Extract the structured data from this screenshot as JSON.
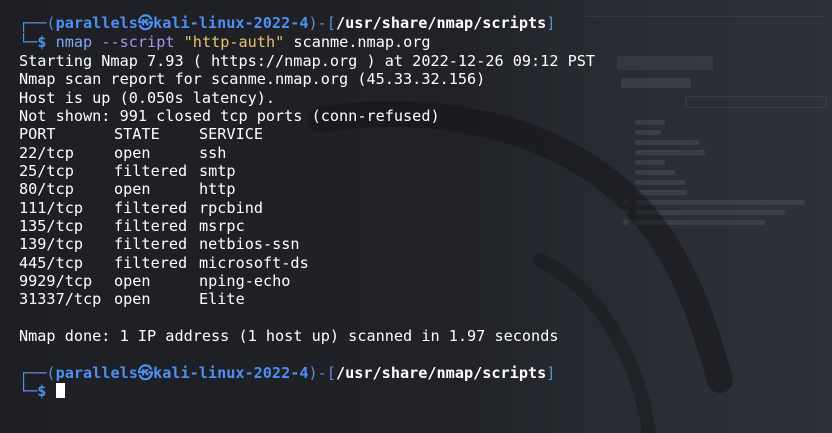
{
  "prompt": {
    "user": "parallels",
    "at_symbol": "㉿",
    "host": "kali-linux-2022-4",
    "path": "/usr/share/nmap/scripts",
    "symbol": "$"
  },
  "command": {
    "program": "nmap",
    "option": "--script",
    "script_name": "\"http-auth\"",
    "target": "scanme.nmap.org"
  },
  "output": {
    "start_line": "Starting Nmap 7.93 ( https://nmap.org ) at 2022-12-26 09:12 PST",
    "report_line": "Nmap scan report for scanme.nmap.org (45.33.32.156)",
    "host_up": "Host is up (0.050s latency).",
    "not_shown": "Not shown: 991 closed tcp ports (conn-refused)",
    "headers": {
      "port": "PORT",
      "state": "STATE",
      "service": "SERVICE"
    },
    "ports": [
      {
        "port": "22/tcp",
        "state": "open",
        "service": "ssh"
      },
      {
        "port": "25/tcp",
        "state": "filtered",
        "service": "smtp"
      },
      {
        "port": "80/tcp",
        "state": "open",
        "service": "http"
      },
      {
        "port": "111/tcp",
        "state": "filtered",
        "service": "rpcbind"
      },
      {
        "port": "135/tcp",
        "state": "filtered",
        "service": "msrpc"
      },
      {
        "port": "139/tcp",
        "state": "filtered",
        "service": "netbios-ssn"
      },
      {
        "port": "445/tcp",
        "state": "filtered",
        "service": "microsoft-ds"
      },
      {
        "port": "9929/tcp",
        "state": "open",
        "service": "nping-echo"
      },
      {
        "port": "31337/tcp",
        "state": "open",
        "service": "Elite"
      }
    ],
    "done_line": "Nmap done: 1 IP address (1 host up) scanned in 1.97 seconds"
  },
  "colors": {
    "background": "#1e2025",
    "prompt_frame": "#5c8fd6",
    "prompt_user": "#4f8ff2",
    "command": "#7fa7f5",
    "option": "#b18ee6",
    "string": "#e6c36b"
  }
}
